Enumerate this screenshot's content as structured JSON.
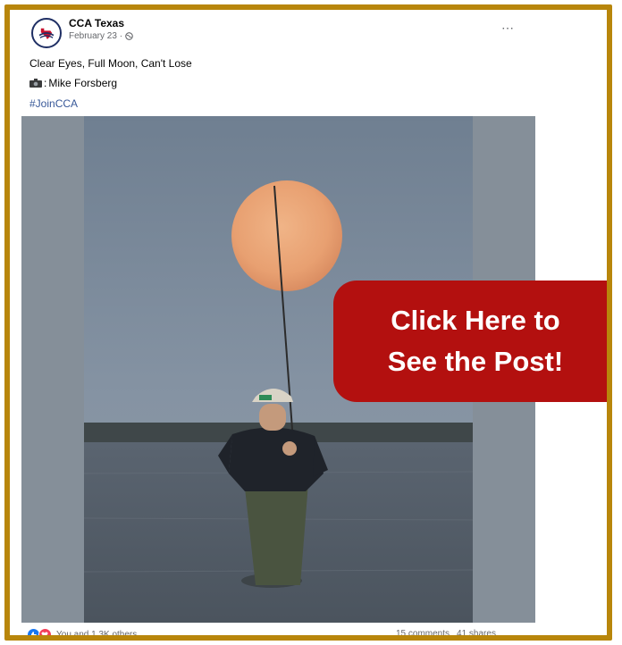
{
  "post": {
    "page_name": "CCA Texas",
    "date": "February 23 ·",
    "caption": "Clear Eyes, Full Moon, Can't Lose",
    "photo_credit": "Mike Forsberg",
    "hashtag": "#JoinCCA",
    "more_icon": "⋯"
  },
  "overlay": {
    "line1": "Click Here to",
    "line2": "See the Post!"
  },
  "footer": {
    "reactions_text": "You and 1.3K others",
    "comments": "15 comments",
    "shares": "41 shares"
  },
  "colors": {
    "frame_border": "#b8860b",
    "cta_background": "#b3100f",
    "link": "#385898"
  },
  "icons": [
    "globe-icon",
    "camera-icon",
    "like-icon",
    "love-icon",
    "more-icon"
  ]
}
